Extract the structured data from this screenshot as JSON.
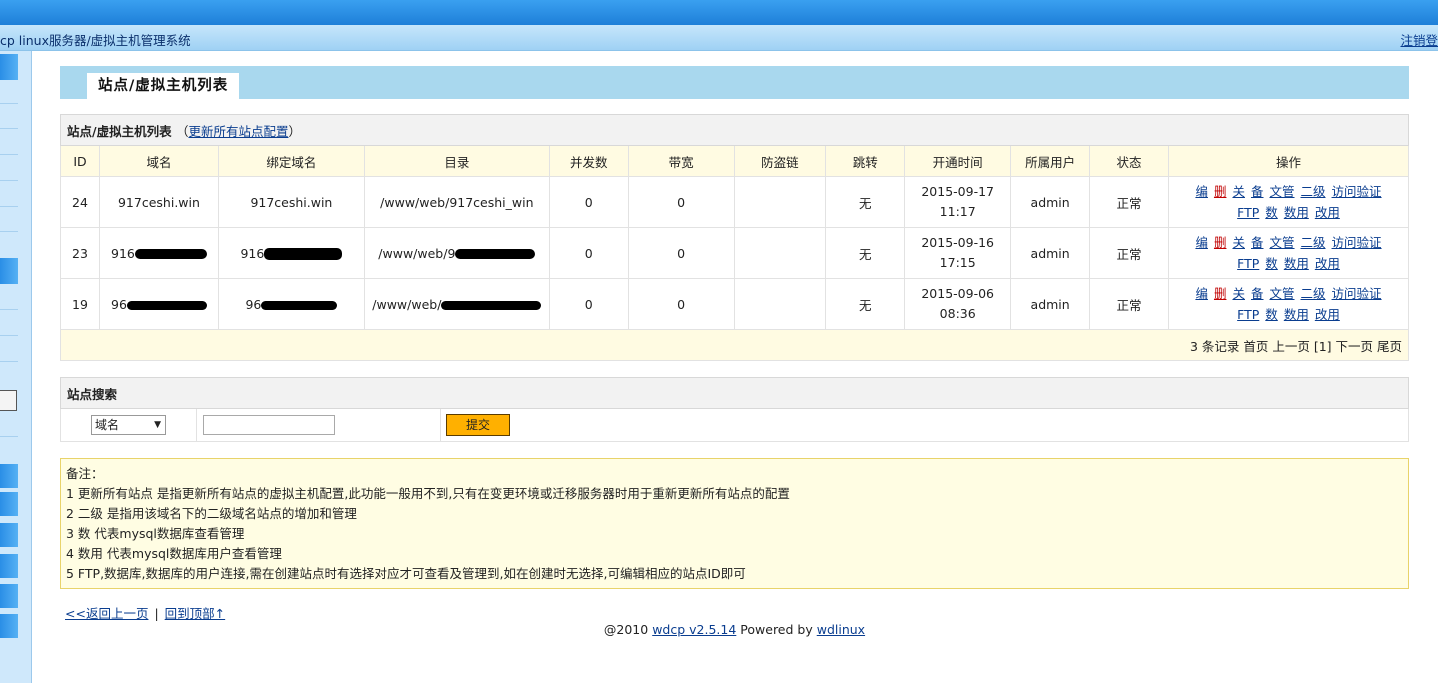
{
  "window": {
    "app_title": "cp linux服务器/虚拟主机管理系统",
    "logout_label": "注销登"
  },
  "header": {
    "tab_title": "站点/虚拟主机列表"
  },
  "list_section": {
    "title": "站点/虚拟主机列表",
    "paren_open": "（",
    "refresh_link": "更新所有站点配置",
    "paren_close": "）"
  },
  "table": {
    "columns": [
      "ID",
      "域名",
      "绑定域名",
      "目录",
      "并发数",
      "带宽",
      "防盗链",
      "跳转",
      "开通时间",
      "所属用户",
      "状态",
      "操作"
    ],
    "rows": [
      {
        "id": "24",
        "domain": "917ceshi.win",
        "bind_domain": "917ceshi.win",
        "dir": "/www/web/917ceshi_win",
        "concurrency": "0",
        "bandwidth": "0",
        "hotlink": "",
        "redirect": "无",
        "open_date": "2015-09-17",
        "open_time": "11:17",
        "owner": "admin",
        "status": "正常"
      },
      {
        "id": "23",
        "domain": "916",
        "bind_domain": "916",
        "dir": "/www/web/9",
        "concurrency": "0",
        "bandwidth": "0",
        "hotlink": "",
        "redirect": "无",
        "open_date": "2015-09-16",
        "open_time": "17:15",
        "owner": "admin",
        "status": "正常"
      },
      {
        "id": "19",
        "domain": "96",
        "bind_domain": "96",
        "dir": "/www/web/",
        "concurrency": "0",
        "bandwidth": "0",
        "hotlink": "",
        "redirect": "无",
        "open_date": "2015-09-06",
        "open_time": "08:36",
        "owner": "admin",
        "status": "正常"
      }
    ],
    "actions": {
      "edit": "编",
      "delete": "删",
      "close": "关",
      "backup": "备",
      "file_manager": "文管",
      "subdomain": "二级",
      "access_auth": "访问验证",
      "ftp": "FTP",
      "db": "数",
      "db_user": "数用",
      "change": "改用"
    },
    "pager": "3 条记录  首页  上一页  [1]  下一页  尾页"
  },
  "search": {
    "title": "站点搜索",
    "select_value": "域名",
    "input_value": "",
    "submit_label": "提交"
  },
  "notes": {
    "heading": "备注：",
    "lines": [
      "1 更新所有站点 是指更新所有站点的虚拟主机配置,此功能一般用不到,只有在变更环境或迁移服务器时用于重新更新所有站点的配置",
      "2 二级 是指用该域名下的二级域名站点的增加和管理",
      "3 数 代表mysql数据库查看管理",
      "4 数用 代表mysql数据库用户查看管理",
      "5 FTP,数据库,数据库的用户连接,需在创建站点时有选择对应才可查看及管理到,如在创建时无选择,可编辑相应的站点ID即可"
    ]
  },
  "links": {
    "back": "<<返回上一页",
    "sep": "|",
    "top": "回到顶部↑"
  },
  "footer": {
    "prefix": "@2010 ",
    "version_link": "wdcp  v2.5.14",
    "powered": " Powered by ",
    "vendor_link": "wdlinux"
  },
  "colors": {
    "topbar": "#1e7fd8",
    "header_band": "#a9d8ee",
    "submit": "#ffb000",
    "delete_link": "#c00000"
  }
}
